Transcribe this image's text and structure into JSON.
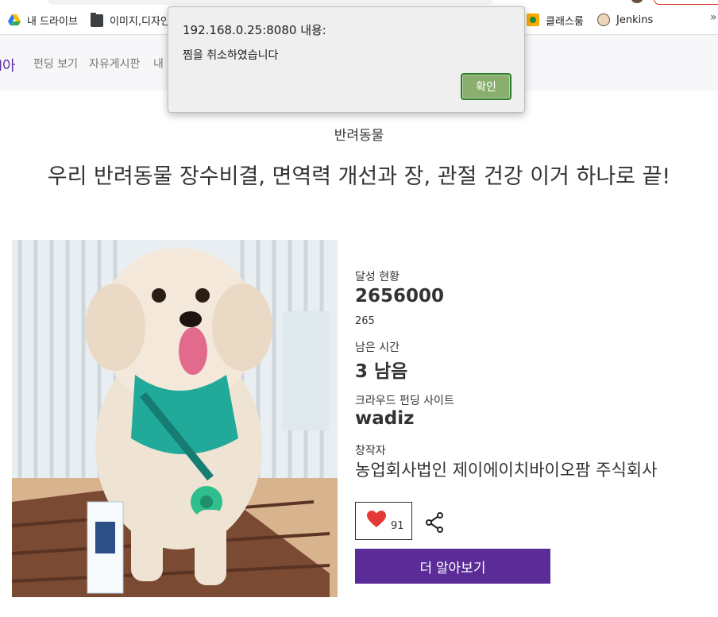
{
  "browser": {
    "bookmarks": [
      {
        "label": "내 드라이브",
        "icon": "google-drive-icon"
      },
      {
        "label": "이미지,디자인",
        "icon": "folder-icon"
      },
      {
        "label": "클래스룸",
        "icon": "classroom-icon"
      },
      {
        "label": "Jenkins",
        "icon": "jenkins-icon"
      }
    ],
    "overflow": "»"
  },
  "nav": {
    "logo_partial": "l아",
    "links": [
      "펀딩 보기",
      "자유게시판",
      "내 "
    ]
  },
  "project": {
    "category": "반려동물",
    "title": "우리 반려동물 장수비결, 면역력 개선과 장, 관절 건강 이거 하나로 끝!",
    "achievement_label": "달성 현황",
    "achievement_amount": "2656000",
    "achievement_rate": "265",
    "remaining_label": "남은 시간",
    "remaining_value": "3 남음",
    "site_label": "크라우드 펀딩 사이트",
    "site_value": "wadiz",
    "creator_label": "창작자",
    "creator_value": "농업회사법인 제이에이치바이오팜 주식회사",
    "like_count": "91",
    "more_button": "더 알아보기"
  },
  "dialog": {
    "title": "192.168.0.25:8080 내용:",
    "message": "찜을 취소하였습니다",
    "ok_label": "확인"
  },
  "colors": {
    "brand_purple": "#5b2c98",
    "heart_red": "#e53935",
    "dialog_ok": "#8aae6e"
  }
}
